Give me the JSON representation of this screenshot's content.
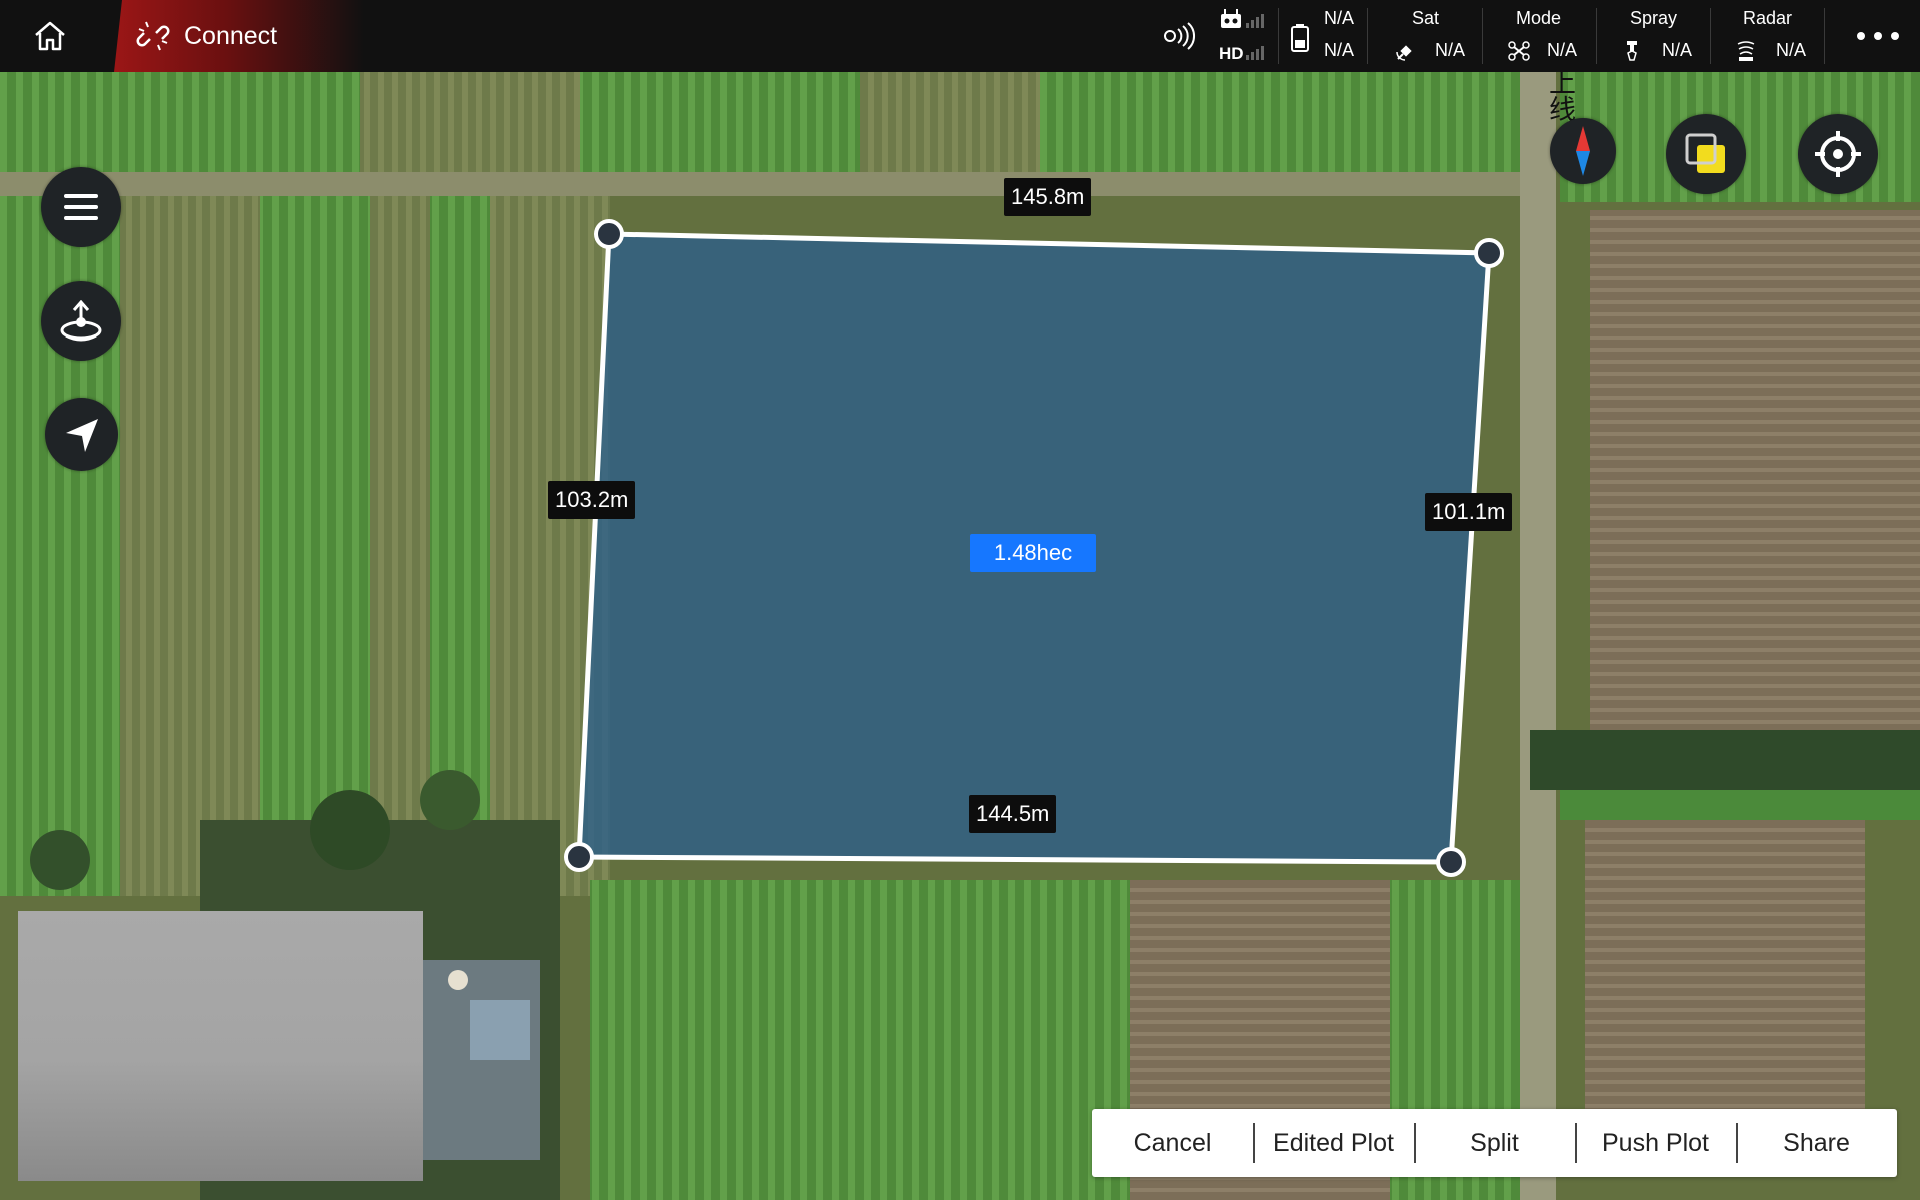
{
  "app": {
    "connect_label": "Connect"
  },
  "status_bar": {
    "link_values": [
      "N/A",
      "N/A"
    ],
    "hd_label": "HD",
    "sat": {
      "label": "Sat",
      "value": "N/A"
    },
    "mode": {
      "label": "Mode",
      "value": "N/A"
    },
    "spray": {
      "label": "Spray",
      "value": "N/A"
    },
    "radar": {
      "label": "Radar",
      "value": "N/A"
    },
    "more_icon": "more-dots-icon"
  },
  "map": {
    "overlay_text": "上线",
    "plot": {
      "area": "1.48hec",
      "edge_top": "145.8m",
      "edge_left": "103.2m",
      "edge_right": "101.1m",
      "edge_bottom": "144.5m"
    }
  },
  "left_tools": [
    "menu-icon",
    "takeoff-point-icon",
    "navigate-arrow-icon"
  ],
  "right_tools": [
    "compass-icon",
    "map-layer-icon",
    "locate-crosshair-icon"
  ],
  "actions": {
    "cancel": "Cancel",
    "edited_plot": "Edited Plot",
    "split": "Split",
    "push_plot": "Push Plot",
    "share": "Share"
  },
  "colors": {
    "accent": "#1677ff",
    "connect_red": "#9b1616",
    "plot_fill": "#2b5f8a"
  }
}
